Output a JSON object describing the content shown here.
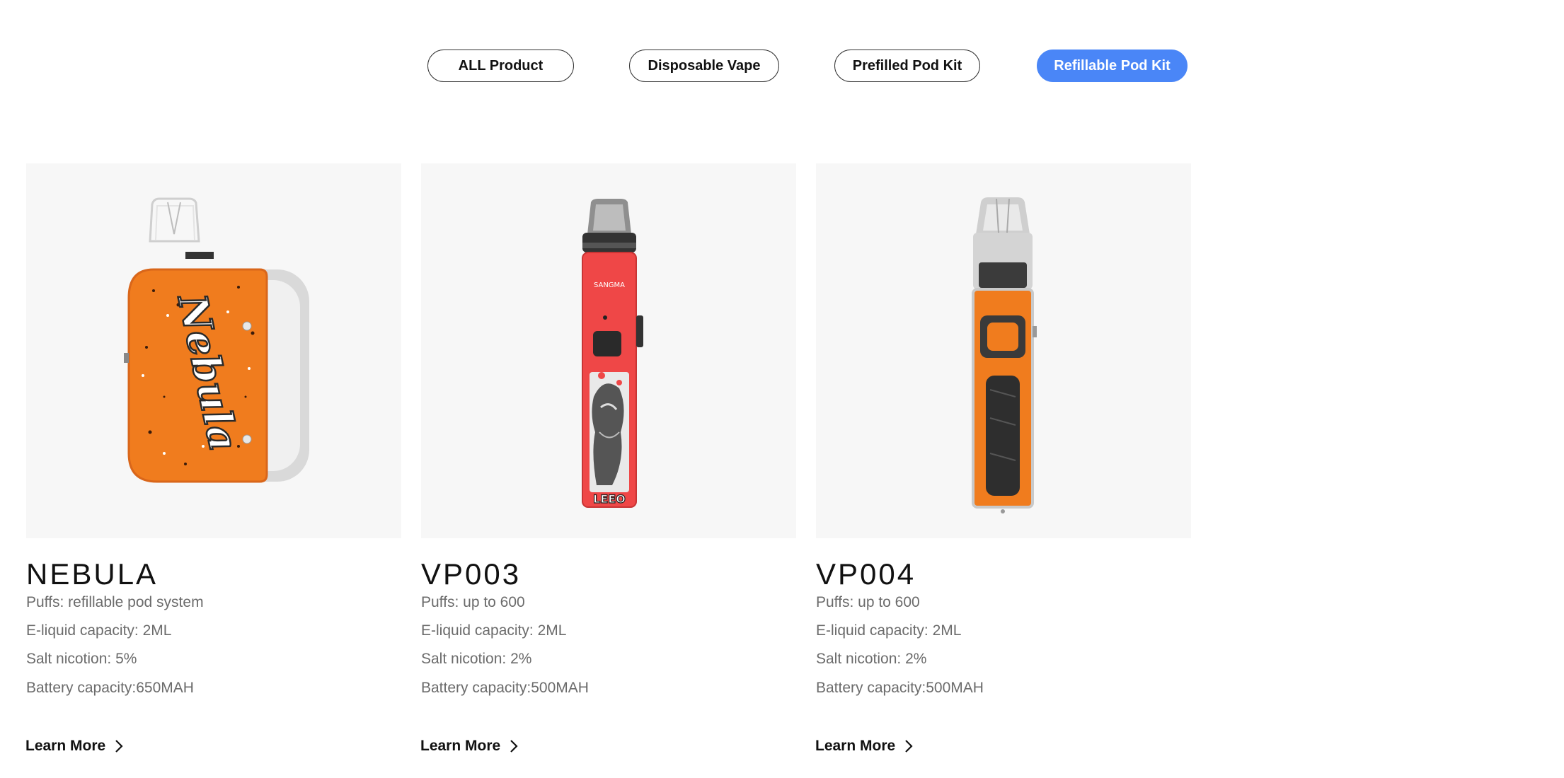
{
  "filters": [
    {
      "label": "ALL Product",
      "active": false
    },
    {
      "label": "Disposable Vape",
      "active": false
    },
    {
      "label": "Prefilled Pod Kit",
      "active": false
    },
    {
      "label": "Refillable Pod Kit",
      "active": true
    }
  ],
  "products": [
    {
      "name": "NEBULA",
      "specs": [
        "Puffs: refillable pod system",
        "E-liquid capacity: 2ML",
        "Salt nicotion: 5%",
        "Battery capacity:650MAH"
      ],
      "learn_more": "Learn More",
      "image": {
        "icon": "nebula-pod-device-image",
        "body_color": "#f07c1e",
        "logo_text": "Nebula"
      }
    },
    {
      "name": "VP003",
      "specs": [
        "Puffs: up to 600",
        "E-liquid capacity: 2ML",
        "Salt nicotion: 2%",
        "Battery capacity:500MAH"
      ],
      "learn_more": "Learn More",
      "image": {
        "icon": "vp003-pen-device-image",
        "body_color": "#ef4747",
        "logo_text": "SANGMA"
      }
    },
    {
      "name": "VP004",
      "specs": [
        "Puffs: up to 600",
        "E-liquid capacity: 2ML",
        "Salt nicotion: 2%",
        "Battery capacity:500MAH"
      ],
      "learn_more": "Learn More",
      "image": {
        "icon": "vp004-pen-device-image",
        "body_color": "#f07c1e"
      }
    }
  ],
  "colors": {
    "accent": "#4a86f7",
    "card_bg": "#f7f7f7",
    "spec_text": "#6b6b6b"
  }
}
